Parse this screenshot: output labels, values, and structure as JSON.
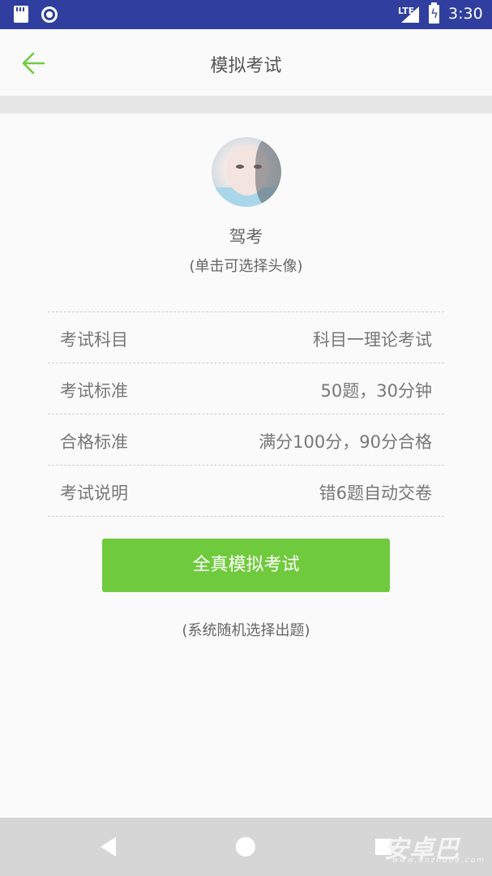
{
  "status_bar": {
    "network": "LTE",
    "time": "3:30",
    "bg_color": "#303f9f"
  },
  "header": {
    "title": "模拟考试",
    "back_icon": "arrow-left-icon",
    "accent": "#6fcb3d"
  },
  "profile": {
    "name": "驾考",
    "hint": "(单击可选择头像)"
  },
  "info_rows": [
    {
      "label": "考试科目",
      "value": "科目一理论考试"
    },
    {
      "label": "考试标准",
      "value": "50题，30分钟"
    },
    {
      "label": "合格标准",
      "value": "满分100分，90分合格"
    },
    {
      "label": "考试说明",
      "value": "错6题自动交卷"
    }
  ],
  "start_button": {
    "label": "全真模拟考试",
    "color": "#6fcb3d"
  },
  "note": "(系统随机选择出题)",
  "watermark": {
    "text": "安卓巴",
    "sub": "www.anzhuo8.com"
  }
}
